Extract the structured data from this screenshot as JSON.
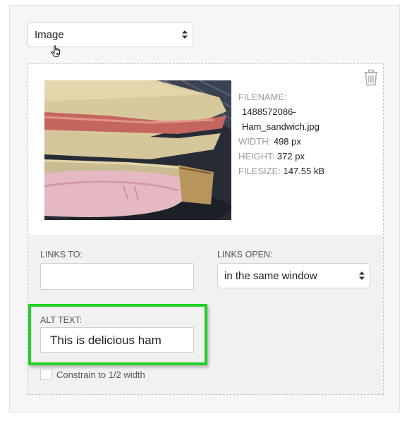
{
  "block_type_select": {
    "value": "Image"
  },
  "image": {
    "alt": "Ham sandwich",
    "meta": {
      "filename_label": "FILENAME:",
      "filename_line1": "1488572086-",
      "filename_line2": "Ham_sandwich.jpg",
      "width_label": "WIDTH:",
      "width_value": "498 px",
      "height_label": "HEIGHT:",
      "height_value": "372 px",
      "filesize_label": "FILESIZE:",
      "filesize_value": "147.55 kB"
    }
  },
  "links_to": {
    "label": "LINKS TO:",
    "value": ""
  },
  "links_open": {
    "label": "LINKS OPEN:",
    "value": "in the same window"
  },
  "alt_text": {
    "label": "ALT TEXT:",
    "value": "This is delicious ham"
  },
  "constrain": {
    "label": "Constrain to 1/2 width",
    "checked": false
  },
  "colors": {
    "highlight": "#23d023",
    "panel": "#f6f6f6"
  },
  "icons": {
    "trash": "trash-icon",
    "select_arrows": "up-down-arrows-icon",
    "cursor": "hand-pointer-icon"
  }
}
